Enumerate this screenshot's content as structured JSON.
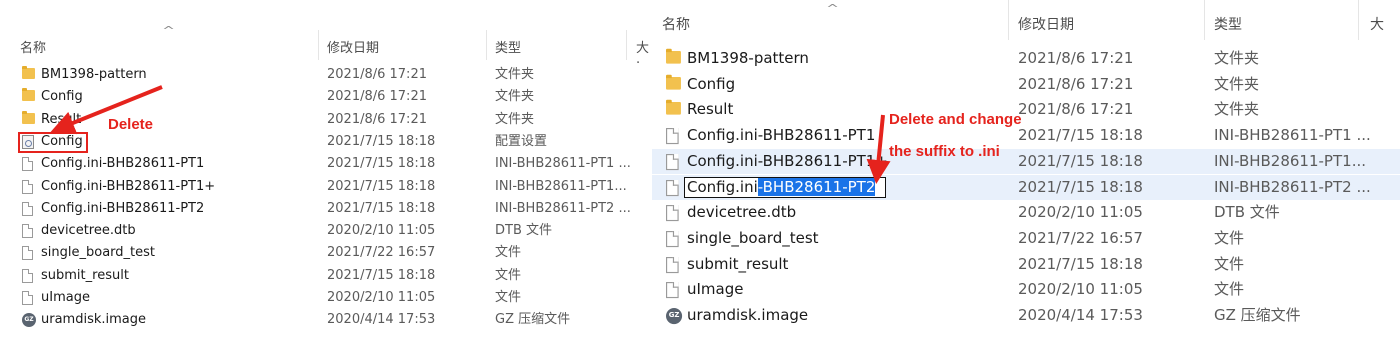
{
  "left": {
    "headers": {
      "name": "名称",
      "date": "修改日期",
      "type": "类型",
      "size": "大·"
    },
    "rows": [
      {
        "icon": "folder",
        "name": "BM1398-pattern",
        "date": "2021/8/6 17:21",
        "type": "文件夹"
      },
      {
        "icon": "folder",
        "name": "Config",
        "date": "2021/8/6 17:21",
        "type": "文件夹"
      },
      {
        "icon": "folder",
        "name": "Result",
        "date": "2021/8/6 17:21",
        "type": "文件夹"
      },
      {
        "icon": "config-settings",
        "name": "Config",
        "date": "2021/7/15 18:18",
        "type": "配置设置"
      },
      {
        "icon": "file",
        "name": "Config.ini-BHB28611-PT1",
        "date": "2021/7/15 18:18",
        "type": "INI-BHB28611-PT1 ..."
      },
      {
        "icon": "file",
        "name": "Config.ini-BHB28611-PT1+",
        "date": "2021/7/15 18:18",
        "type": "INI-BHB28611-PT1..."
      },
      {
        "icon": "file",
        "name": "Config.ini-BHB28611-PT2",
        "date": "2021/7/15 18:18",
        "type": "INI-BHB28611-PT2 ..."
      },
      {
        "icon": "file",
        "name": "devicetree.dtb",
        "date": "2020/2/10 11:05",
        "type": "DTB 文件"
      },
      {
        "icon": "file",
        "name": "single_board_test",
        "date": "2021/7/22 16:57",
        "type": "文件"
      },
      {
        "icon": "file",
        "name": "submit_result",
        "date": "2021/7/15 18:18",
        "type": "文件"
      },
      {
        "icon": "file",
        "name": "uImage",
        "date": "2020/2/10 11:05",
        "type": "文件"
      },
      {
        "icon": "gz-archive",
        "name": "uramdisk.image",
        "date": "2020/4/14 17:53",
        "type": "GZ 压缩文件"
      }
    ],
    "annotation": "Delete"
  },
  "right": {
    "headers": {
      "name": "名称",
      "date": "修改日期",
      "type": "类型",
      "size": "大"
    },
    "rows": [
      {
        "icon": "folder",
        "name": "BM1398-pattern",
        "date": "2021/8/6 17:21",
        "type": "文件夹"
      },
      {
        "icon": "folder",
        "name": "Config",
        "date": "2021/8/6 17:21",
        "type": "文件夹"
      },
      {
        "icon": "folder",
        "name": "Result",
        "date": "2021/8/6 17:21",
        "type": "文件夹"
      },
      {
        "icon": "file",
        "name": "Config.ini-BHB28611-PT1",
        "date": "2021/7/15 18:18",
        "type": "INI-BHB28611-PT1 ..."
      },
      {
        "icon": "file",
        "name": "Config.ini-BHB28611-PT1+",
        "date": "2021/7/15 18:18",
        "type": "INI-BHB28611-PT1..."
      },
      {
        "icon": "file",
        "name": "Config.ini-BHB28611-PT2",
        "date": "2021/7/15 18:18",
        "type": "INI-BHB28611-PT2 ..."
      },
      {
        "icon": "file",
        "name": "devicetree.dtb",
        "date": "2020/2/10 11:05",
        "type": "DTB 文件"
      },
      {
        "icon": "file",
        "name": "single_board_test",
        "date": "2021/7/22 16:57",
        "type": "文件"
      },
      {
        "icon": "file",
        "name": "submit_result",
        "date": "2021/7/15 18:18",
        "type": "文件"
      },
      {
        "icon": "file",
        "name": "uImage",
        "date": "2020/2/10 11:05",
        "type": "文件"
      },
      {
        "icon": "gz-archive",
        "name": "uramdisk.image",
        "date": "2020/4/14 17:53",
        "type": "GZ 压缩文件"
      }
    ],
    "rename": {
      "prefix": "Config.ini",
      "selected": "-BHB28611-PT2"
    },
    "annotation_line1": "Delete and change",
    "annotation_line2": "the suffix to .ini"
  },
  "gz_label": "GZ",
  "colors": {
    "annotation": "#e5231d",
    "selection": "#1a73e8",
    "row_highlight": "#e8f0fb",
    "folder": "#f2c14e"
  }
}
